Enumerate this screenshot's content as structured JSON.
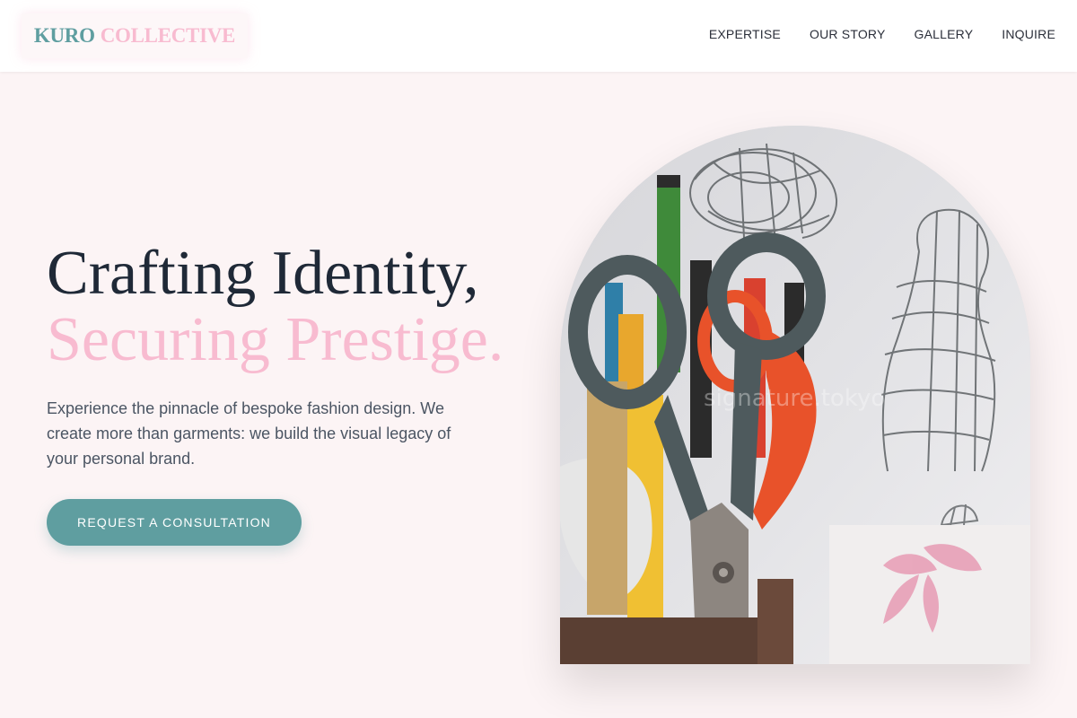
{
  "header": {
    "logo_primary": "KURO",
    "logo_secondary": "COLLECTIVE",
    "nav": [
      {
        "label": "EXPERTISE"
      },
      {
        "label": "OUR STORY"
      },
      {
        "label": "GALLERY"
      },
      {
        "label": "INQUIRE"
      }
    ]
  },
  "hero": {
    "headline_line1": "Crafting Identity,",
    "headline_line2": "Securing Prestige.",
    "description": "Experience the pinnacle of bespoke fashion design. We create more than garments: we build the visual legacy of your personal brand.",
    "cta_label": "REQUEST A CONSULTATION",
    "image_watermark": "signature.tokyo"
  },
  "colors": {
    "accent_teal": "#5f9ea0",
    "accent_pink": "#f8bbd0",
    "background": "#fcf4f5",
    "heading": "#1f2937"
  }
}
